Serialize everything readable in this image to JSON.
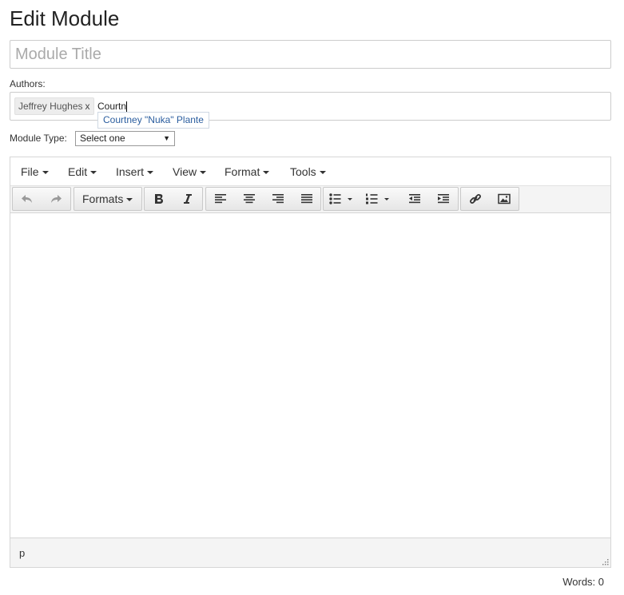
{
  "page": {
    "title": "Edit Module"
  },
  "title_field": {
    "placeholder": "Module Title",
    "value": ""
  },
  "authors": {
    "label": "Authors:",
    "tags": [
      {
        "name": "Jeffrey Hughes",
        "remove": "x"
      }
    ],
    "typed": "Courtn",
    "suggestion": "Courtney \"Nuka\" Plante"
  },
  "module_type": {
    "label": "Module Type:",
    "selected": "Select one"
  },
  "editor": {
    "menu": [
      "File",
      "Edit",
      "Insert",
      "View",
      "Format",
      "Tools"
    ],
    "toolbar": {
      "formats_label": "Formats"
    },
    "path": "p",
    "word_count": "Words: 0"
  }
}
